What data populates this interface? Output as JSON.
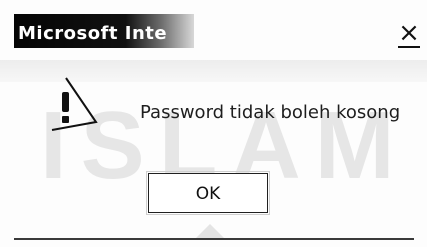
{
  "window": {
    "title": "Microsoft Inte",
    "close_label": "×"
  },
  "dialog": {
    "icon": "warning-icon",
    "message": "Password tidak boleh kosong",
    "ok_label": "OK"
  },
  "background": {
    "watermark_text": "ISLAM"
  },
  "colors": {
    "title_bar": "#000000",
    "title_text": "#ffffff",
    "dialog_bg": "#ffffff",
    "text": "#1e1e1e"
  }
}
